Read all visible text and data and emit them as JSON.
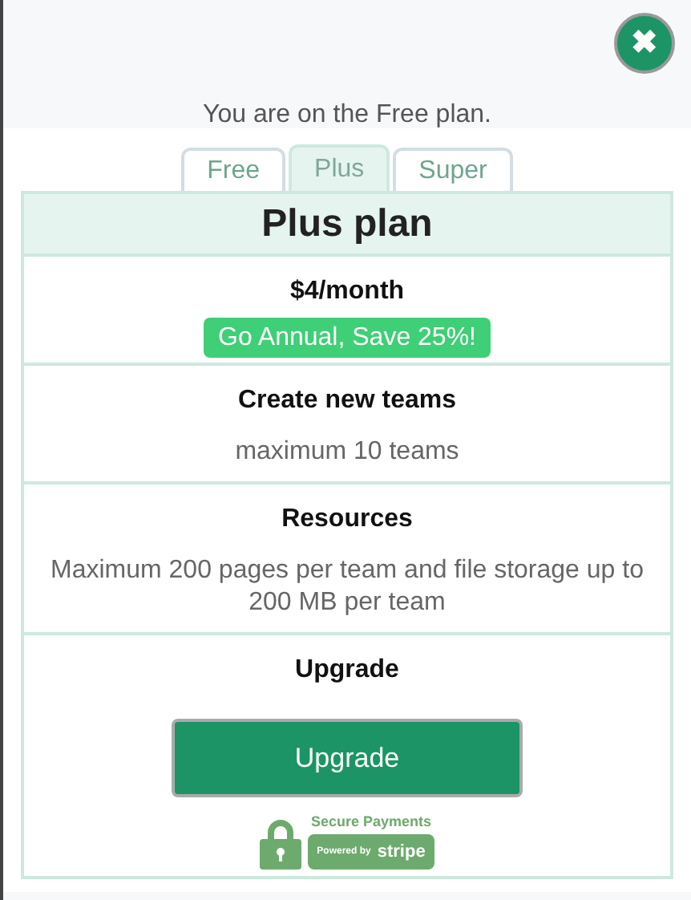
{
  "close_button": {
    "label": "✖"
  },
  "current_plan_text": "You are on the Free plan.",
  "tabs": [
    {
      "label": "Free",
      "selected": false
    },
    {
      "label": "Plus",
      "selected": true
    },
    {
      "label": "Super",
      "selected": false
    }
  ],
  "plan": {
    "title": "Plus plan",
    "price": "$4/month",
    "annual_offer": "Go Annual, Save 25%!",
    "sections": [
      {
        "heading": "Create new teams",
        "text": "maximum 10 teams"
      },
      {
        "heading": "Resources",
        "text": "Maximum 200 pages per team and file storage up to 200 MB per team"
      }
    ],
    "upgrade": {
      "heading": "Upgrade",
      "button": "Upgrade"
    },
    "badge": {
      "title": "Secure Payments",
      "powered_by": "Powered by",
      "brand": "stripe"
    }
  }
}
